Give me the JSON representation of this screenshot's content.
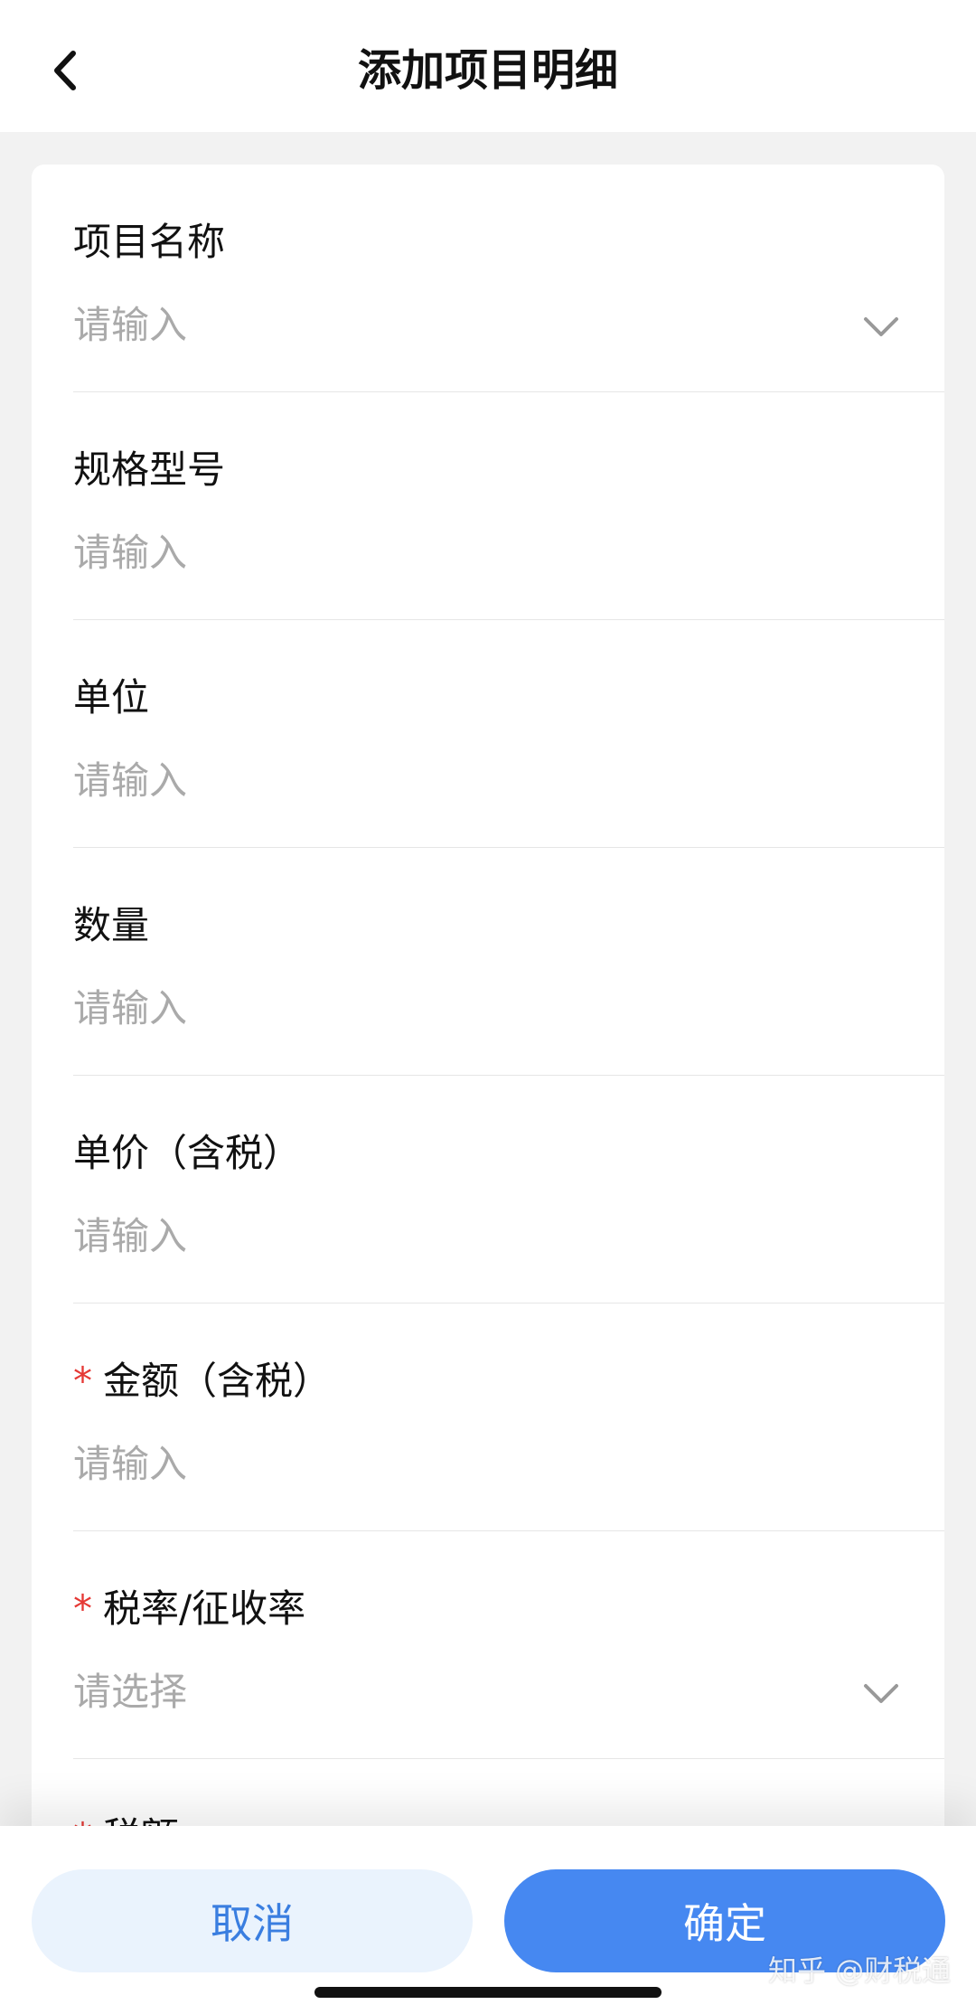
{
  "header": {
    "title": "添加项目明细",
    "back_icon": "chevron-left-icon"
  },
  "form": {
    "fields": [
      {
        "label": "项目名称",
        "required": false,
        "placeholder": "请输入",
        "has_dropdown": true
      },
      {
        "label": "规格型号",
        "required": false,
        "placeholder": "请输入",
        "has_dropdown": false
      },
      {
        "label": "单位",
        "required": false,
        "placeholder": "请输入",
        "has_dropdown": false
      },
      {
        "label": "数量",
        "required": false,
        "placeholder": "请输入",
        "has_dropdown": false
      },
      {
        "label": "单价（含税）",
        "required": false,
        "placeholder": "请输入",
        "has_dropdown": false
      },
      {
        "label": "金额（含税）",
        "required": true,
        "placeholder": "请输入",
        "has_dropdown": false
      },
      {
        "label": "税率/征收率",
        "required": true,
        "placeholder": "请选择",
        "has_dropdown": true
      },
      {
        "label": "税额",
        "required": true,
        "placeholder": "",
        "has_dropdown": false
      }
    ],
    "required_mark": "*"
  },
  "footer": {
    "cancel_label": "取消",
    "confirm_label": "确定"
  },
  "watermark": "知乎 @财税通",
  "colors": {
    "accent": "#4688f1",
    "required": "#e53935",
    "placeholder": "#aaaaaa",
    "background": "#f2f2f2"
  }
}
